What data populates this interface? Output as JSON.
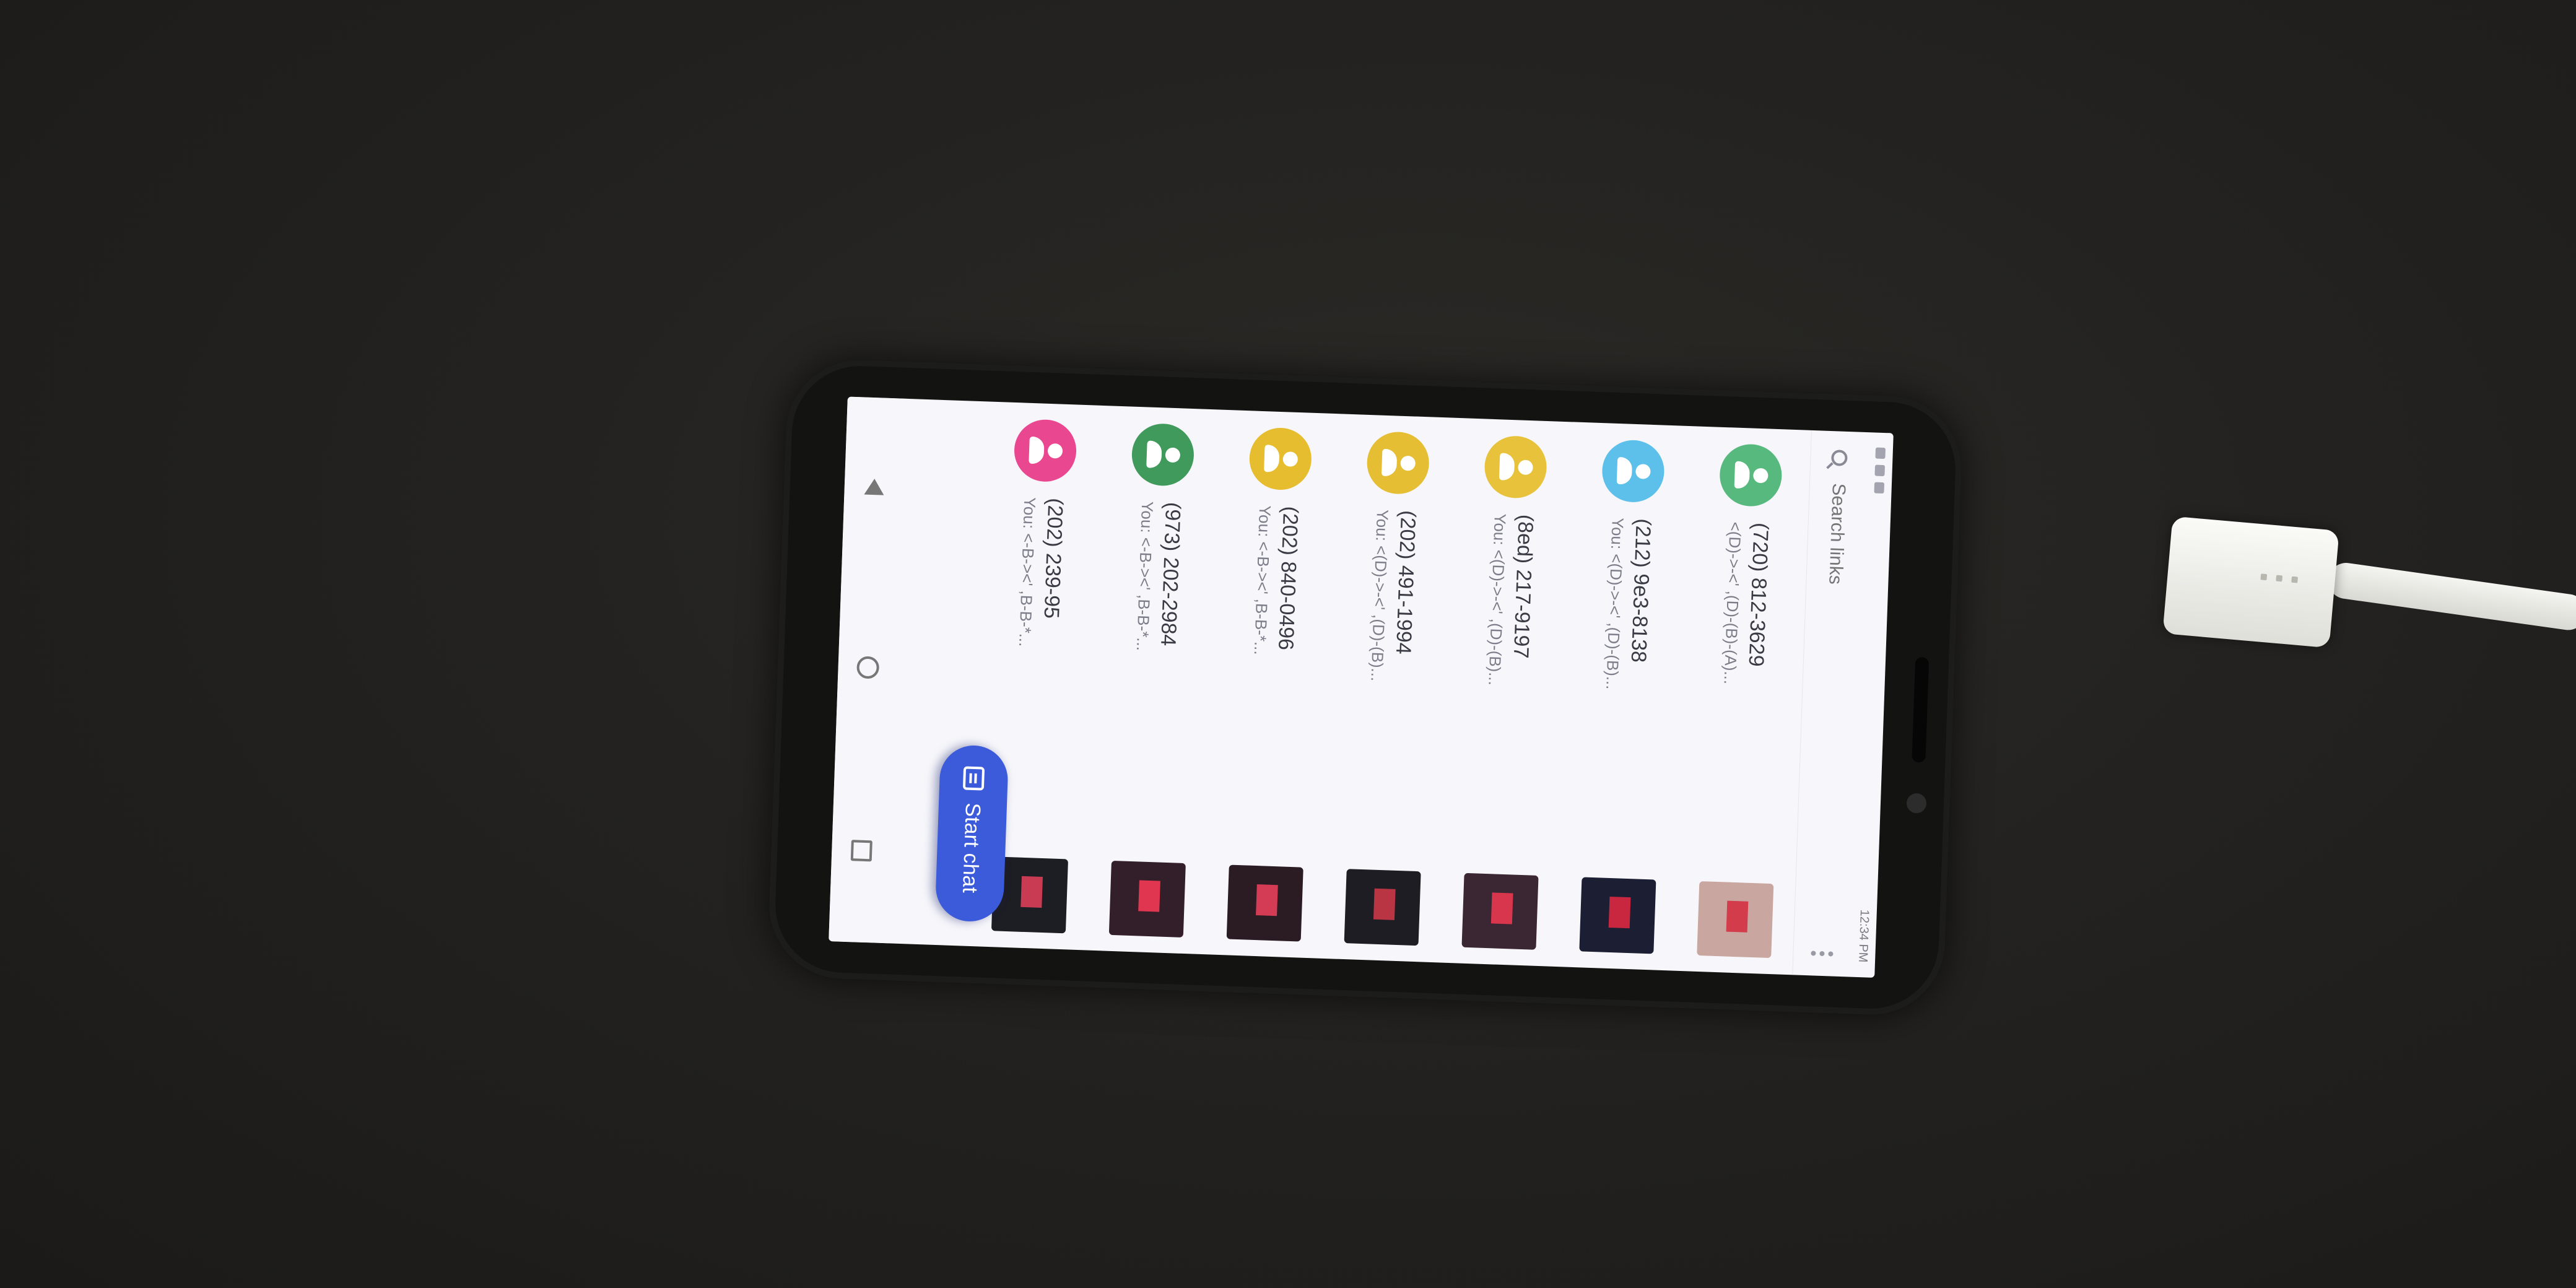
{
  "status": {
    "time": "12:34 PM"
  },
  "search": {
    "placeholder": "Search links"
  },
  "conversations": [
    {
      "name": "(720) 812-3629",
      "preview": "<(D)->-<' ,(D)-(B)-(A)...",
      "avatar_color": "#58b97f",
      "thumb_colors": [
        "#c9a7a0",
        "#d23c4b"
      ]
    },
    {
      "name": "(212) 9e3-8138",
      "preview": "You: <(D)->-<' ,(D)-(B)...",
      "avatar_color": "#5cc0ea",
      "thumb_colors": [
        "#1c1f33",
        "#c8273f"
      ]
    },
    {
      "name": "(8ed) 217-9197",
      "preview": "You: <(D)->-<' ,(D)-(B)...",
      "avatar_color": "#e7c23a",
      "thumb_colors": [
        "#3b2733",
        "#d8364c"
      ]
    },
    {
      "name": "(202) 491-1994",
      "preview": "You: <(D)->-<' ,(D)-(B)...",
      "avatar_color": "#e5be33",
      "thumb_colors": [
        "#1e1d24",
        "#b93544"
      ]
    },
    {
      "name": "(202) 840-0496",
      "preview": "You: <-B-><' ,B-B-*...",
      "avatar_color": "#e7bd30",
      "thumb_colors": [
        "#2b1c24",
        "#d33c54"
      ]
    },
    {
      "name": "(973) 202-2984",
      "preview": "You: <-B-><' ,B-B-*...",
      "avatar_color": "#3f9a5b",
      "thumb_colors": [
        "#331f2a",
        "#e03650"
      ]
    },
    {
      "name": "(202) 239-95",
      "preview": "You: <-B-><' ,B-B-*...",
      "avatar_color": "#e9478f",
      "thumb_colors": [
        "#1d1d24",
        "#c83b53"
      ]
    }
  ],
  "fab": {
    "label": "Start chat"
  }
}
